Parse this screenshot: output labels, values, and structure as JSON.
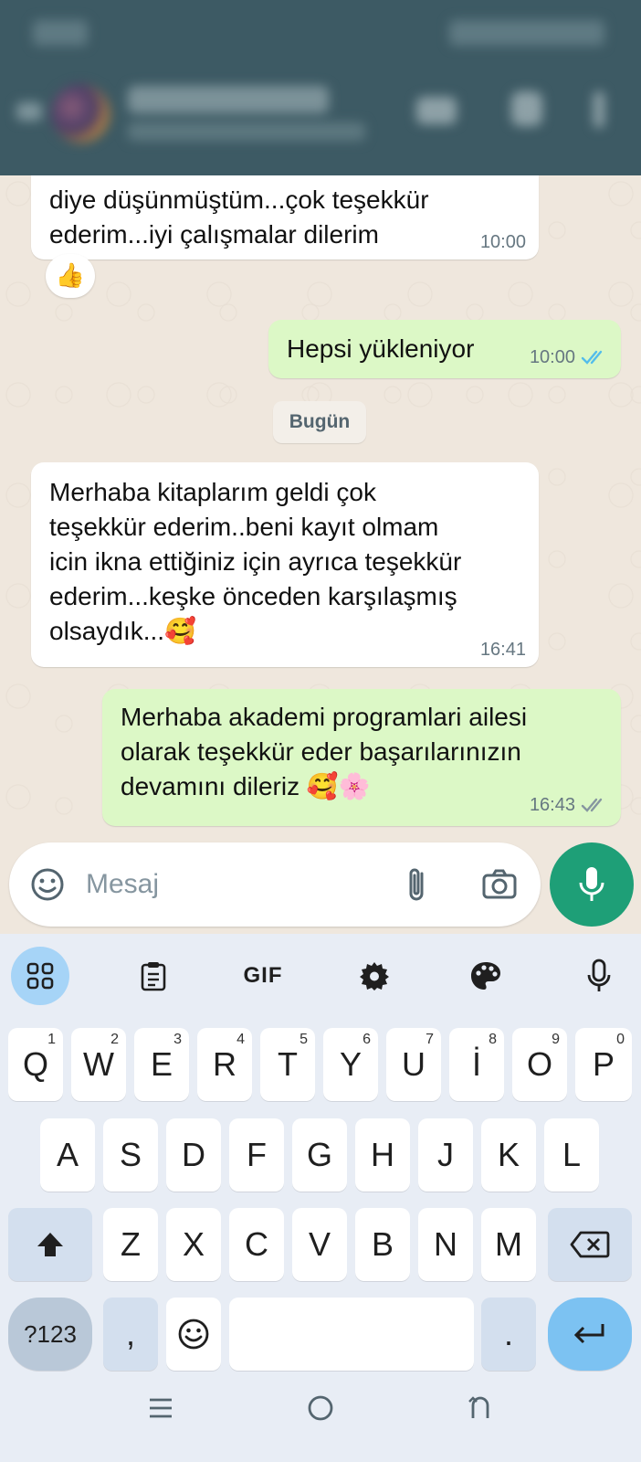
{
  "header": {
    "contact_name": "",
    "contact_subtitle": ""
  },
  "messages": [
    {
      "direction": "in",
      "text": "diye düşünmüştüm...çok teşekkür\nederim...iyi çalışmalar dilerim",
      "time": "10:00",
      "reaction": "👍"
    },
    {
      "direction": "out",
      "text": "Hepsi yükleniyor",
      "time": "10:00",
      "status": "read"
    },
    {
      "direction": "in",
      "text": "Merhaba kitaplarım geldi çok\nteşekkür ederim..beni kayıt olmam\nicin ikna ettiğiniz için ayrıca teşekkür\nederim...keşke önceden karşılaşmış\nolsaydık...🥰",
      "time": "16:41"
    },
    {
      "direction": "out",
      "text": "Merhaba akademi programlari ailesi\nolarak teşekkür eder başarılarınızın\ndevamını dileriz 🥰🌸",
      "time": "16:43",
      "status": "delivered"
    }
  ],
  "date_separator": "Bugün",
  "composer": {
    "placeholder": "Mesaj"
  },
  "keyboard": {
    "toolbar": {
      "gif_label": "GIF",
      "icons": [
        "apps-grid-icon",
        "clipboard-icon",
        "gif-icon",
        "settings-icon",
        "palette-icon",
        "voice-input-icon"
      ]
    },
    "row1": [
      {
        "key": "Q",
        "hint": "1"
      },
      {
        "key": "W",
        "hint": "2"
      },
      {
        "key": "E",
        "hint": "3"
      },
      {
        "key": "R",
        "hint": "4"
      },
      {
        "key": "T",
        "hint": "5"
      },
      {
        "key": "Y",
        "hint": "6"
      },
      {
        "key": "U",
        "hint": "7"
      },
      {
        "key": "İ",
        "hint": "8"
      },
      {
        "key": "O",
        "hint": "9"
      },
      {
        "key": "P",
        "hint": "0"
      }
    ],
    "row2": [
      "A",
      "S",
      "D",
      "F",
      "G",
      "H",
      "J",
      "K",
      "L"
    ],
    "row3": [
      "Z",
      "X",
      "C",
      "V",
      "B",
      "N",
      "M"
    ],
    "row4": {
      "symbols": "?123",
      "comma": ",",
      "period": "."
    }
  },
  "colors": {
    "header_bg": "#3d5a64",
    "chat_bg": "#efe7dd",
    "outgoing_bubble": "#dcf8c6",
    "incoming_bubble": "#ffffff",
    "read_tick": "#53bdeb",
    "mic_fab": "#1e9f77",
    "keyboard_bg": "#e8edf5"
  }
}
